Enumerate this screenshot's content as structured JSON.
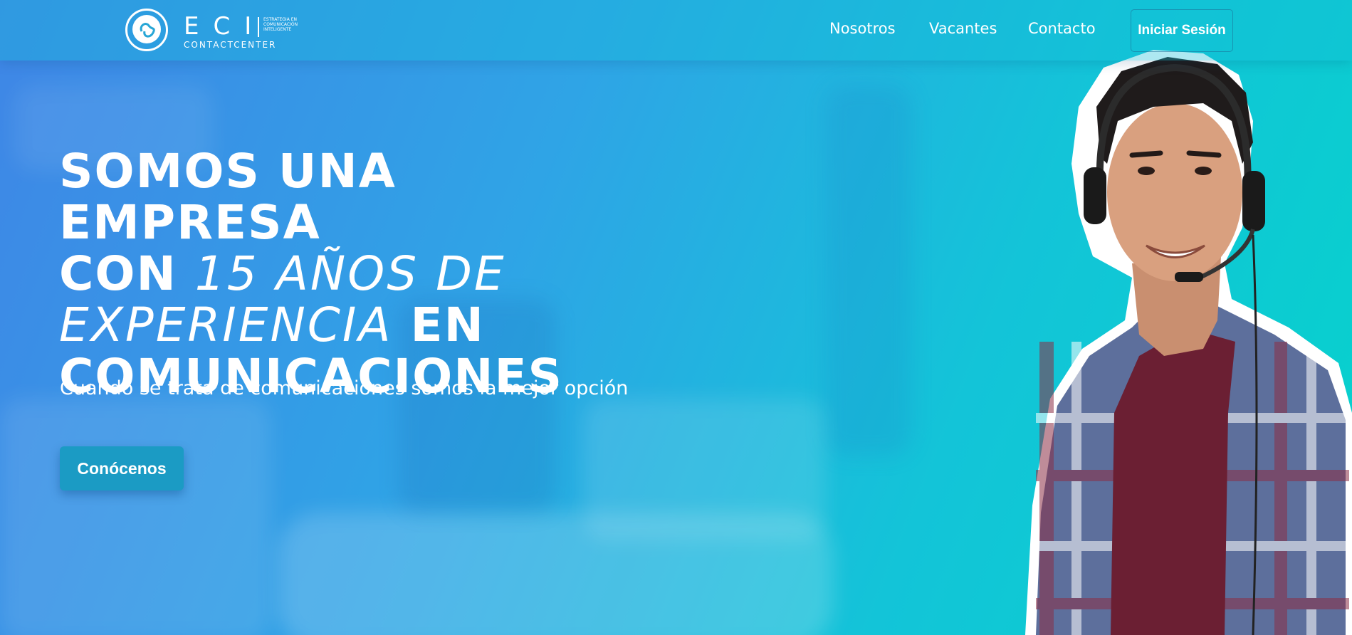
{
  "logo": {
    "letters": "ECI",
    "tagline": "ESTRATEGIA EN COMUNICACIÓN INTELIGENTE",
    "subtitle": "CONTACTCENTER"
  },
  "nav": {
    "items": [
      "Nosotros",
      "Vacantes",
      "Contacto"
    ],
    "login_label": "Iniciar Sesión"
  },
  "hero": {
    "line1": "SOMOS UNA EMPRESA",
    "line2_a": "CON ",
    "line2_em": "15 AÑOS DE",
    "line3_em": "EXPERIENCIA",
    "line3_b": " EN",
    "line4": "COMUNICACIONES",
    "subtitle": "Cuando se trata de comunicaciones somos la mejor opción",
    "cta_label": "Conócenos"
  },
  "colors": {
    "gradient_left": "#3f86e6",
    "gradient_right": "#06d2cc",
    "cta": "#1b9bc4"
  }
}
